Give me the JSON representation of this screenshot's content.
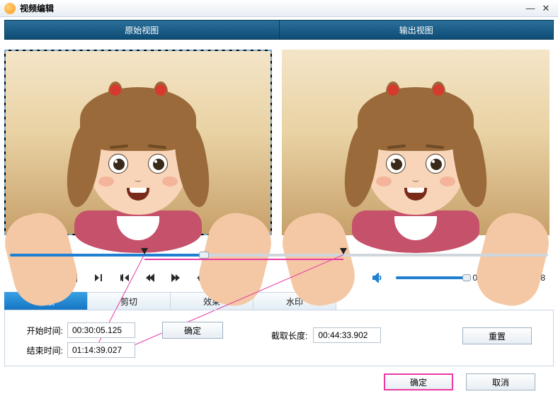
{
  "window": {
    "title": "视频编辑"
  },
  "header": {
    "original": "原始视图",
    "output": "输出视图"
  },
  "timeline": {
    "play_position_pct": 36,
    "range_start_pct": 25,
    "range_end_pct": 62
  },
  "time": {
    "current": "00:43:11",
    "total": "02:01:28",
    "sep": " / "
  },
  "tabs": {
    "clip": "截取",
    "crop": "剪切",
    "effect": "效果",
    "watermark": "水印"
  },
  "clip_panel": {
    "start_label": "开始时间:",
    "start_value": "00:30:05.125",
    "end_label": "结束时间:",
    "end_value": "01:14:39.027",
    "confirm": "确定",
    "length_label": "截取长度:",
    "length_value": "00:44:33.902",
    "reset": "重置"
  },
  "footer": {
    "ok": "确定",
    "cancel": "取消"
  },
  "icons": {
    "play": "play",
    "mark_in": "mark-in",
    "mark_out": "mark-out",
    "frame_back": "frame-back",
    "frame_fwd": "frame-fwd",
    "jump_start": "jump-start",
    "jump_end": "jump-end",
    "tool_a": "tool-a",
    "tool_b": "tool-b",
    "volume": "volume"
  }
}
